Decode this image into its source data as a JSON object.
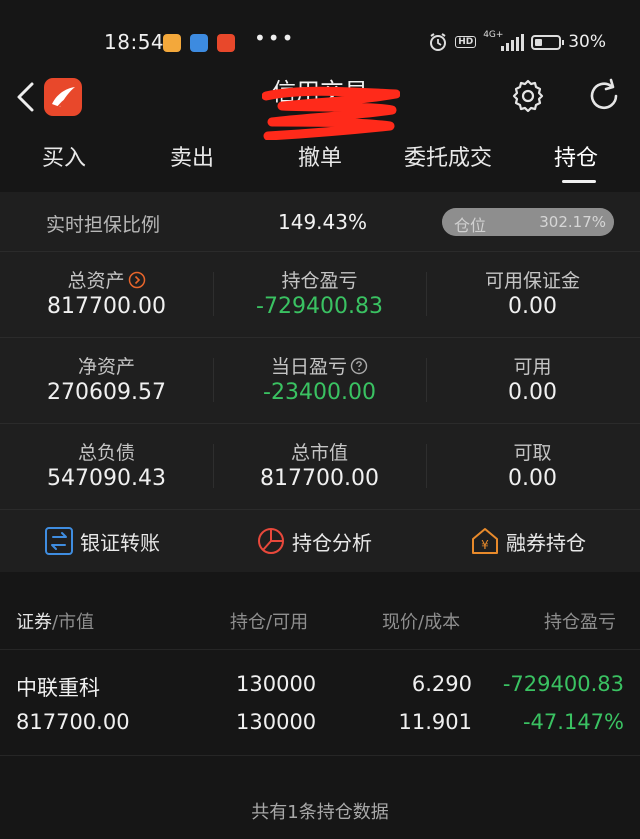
{
  "status_bar": {
    "time": "18:54",
    "dots": "•••",
    "network": "4G+",
    "hd": "HD",
    "battery_pct": "30%",
    "battery_level": 0.3
  },
  "header": {
    "title": "信用交易"
  },
  "tabs": [
    "买入",
    "卖出",
    "撤单",
    "委托成交",
    "持仓"
  ],
  "active_tab": "持仓",
  "account": {
    "ratio_label": "实时担保比例",
    "ratio_value": "149.43%",
    "position_label": "仓位",
    "position_value": "302.17%",
    "total_assets_label": "总资产",
    "total_assets": "817700.00",
    "hold_pl_label": "持仓盈亏",
    "hold_pl": "-729400.83",
    "avail_margin_label": "可用保证金",
    "avail_margin": "0.00",
    "net_assets_label": "净资产",
    "net_assets": "270609.57",
    "day_pl_label": "当日盈亏",
    "day_pl": "-23400.00",
    "available_label": "可用",
    "available": "0.00",
    "total_debt_label": "总负债",
    "total_debt": "547090.43",
    "market_value_label": "总市值",
    "market_value": "817700.00",
    "withdrawable_label": "可取",
    "withdrawable": "0.00"
  },
  "actions": {
    "transfer": "银证转账",
    "analysis": "持仓分析",
    "short": "融券持仓"
  },
  "holdings": {
    "col1_a": "证券",
    "col1_b": "/市值",
    "col2": "持仓/可用",
    "col3": "现价/成本",
    "col4": "持仓盈亏",
    "rows": [
      {
        "name": "中联重科",
        "market_value": "817700.00",
        "position": "130000",
        "available": "130000",
        "price": "6.290",
        "cost": "11.901",
        "pl": "-729400.83",
        "pl_pct": "-47.147%"
      }
    ],
    "footer": "共有1条持仓数据"
  },
  "colors": {
    "accent_green": "#3ac262",
    "logo": "#e8482b",
    "background": "#161616"
  }
}
